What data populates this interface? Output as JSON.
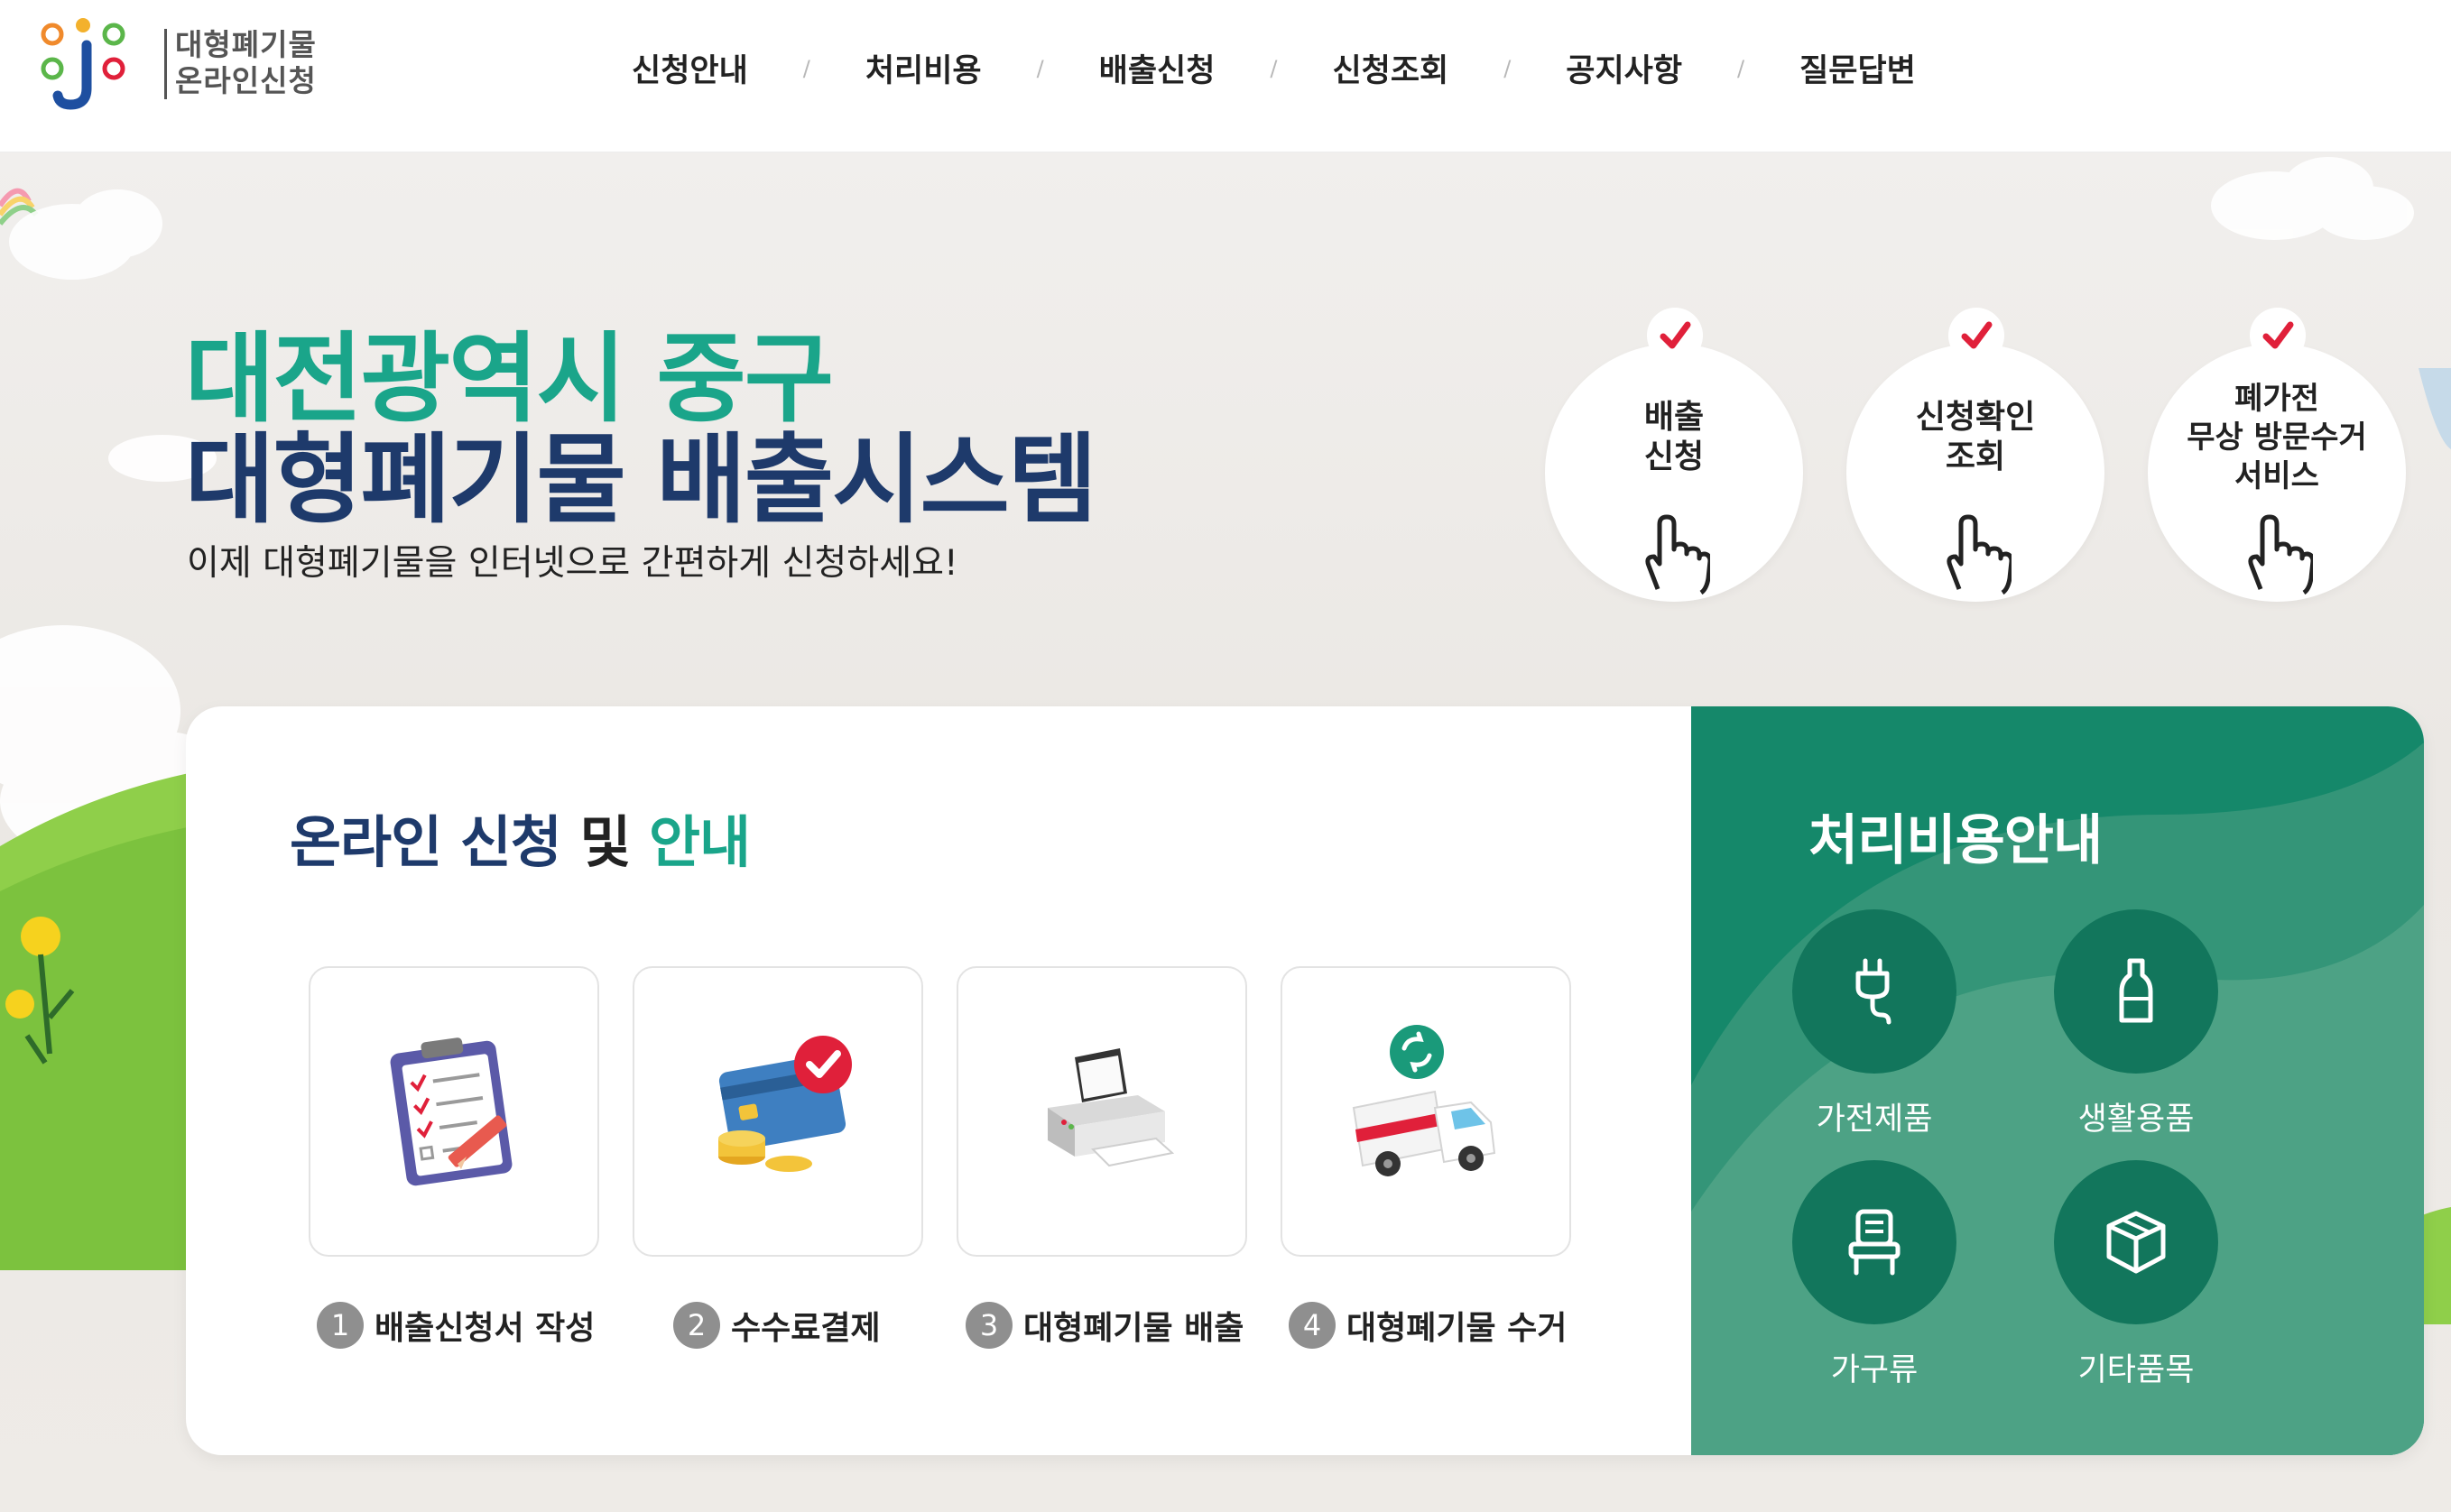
{
  "header": {
    "logo_line1": "대형폐기물",
    "logo_line2": "온라인신청",
    "nav": [
      "신청안내",
      "처리비용",
      "배출신청",
      "신청조회",
      "공지사항",
      "질문답변"
    ],
    "nav_separator": "/"
  },
  "hero": {
    "title_line1": "대전광역시 중구",
    "title_line2": "대형폐기물 배출시스템",
    "subtitle": "이제 대형폐기물을 인터넷으로 간편하게 신청하세요!",
    "quick_links": [
      {
        "line1": "배출",
        "line2": "신청",
        "line3": ""
      },
      {
        "line1": "신청확인",
        "line2": "조회",
        "line3": ""
      },
      {
        "line1": "폐가전",
        "line2": "무상 방문수거",
        "line3": "서비스"
      }
    ]
  },
  "guide": {
    "title_part1": "온라인 신청",
    "title_part2": " 및 ",
    "title_part3": "안내",
    "steps": [
      {
        "num": "1",
        "label": "배출신청서 작성",
        "icon": "clipboard-checklist-icon"
      },
      {
        "num": "2",
        "label": "수수료결제",
        "icon": "credit-card-payment-icon"
      },
      {
        "num": "3",
        "label": "대형폐기물 배출",
        "icon": "printer-icon"
      },
      {
        "num": "4",
        "label": "대형폐기물 수거",
        "icon": "collection-truck-icon"
      }
    ]
  },
  "fees": {
    "title": "처리비용안내",
    "items": [
      {
        "label": "가전제품",
        "icon": "plug-icon"
      },
      {
        "label": "생활용품",
        "icon": "bottle-icon"
      },
      {
        "label": "가구류",
        "icon": "chair-icon"
      },
      {
        "label": "기타품목",
        "icon": "box-icon"
      }
    ]
  },
  "colors": {
    "teal": "#1aa58a",
    "navy": "#1e3a6b",
    "fee_panel": "#15886a",
    "check_red": "#e0203a"
  }
}
